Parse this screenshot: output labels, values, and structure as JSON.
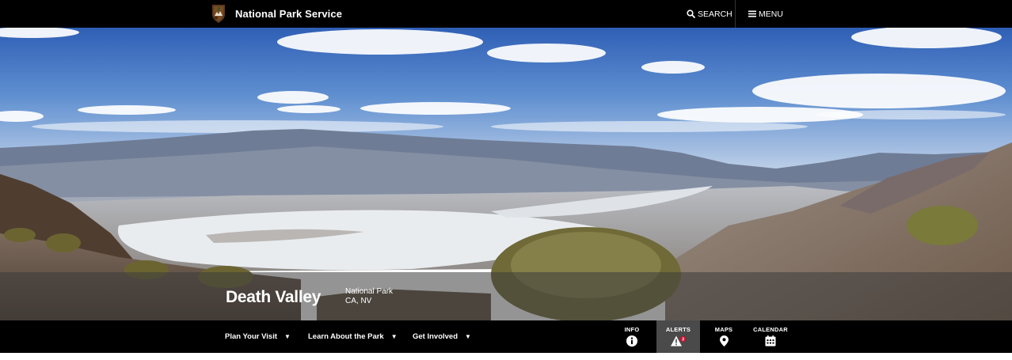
{
  "header": {
    "brand_name": "National Park Service",
    "logo_icon": "nps-arrowhead-icon",
    "search_label": "SEARCH",
    "menu_label": "MENU"
  },
  "hero": {
    "title": "Death Valley",
    "designation": "National Park",
    "location": "CA, NV"
  },
  "nav": {
    "items": [
      {
        "label": "Plan Your Visit",
        "caret": "▼"
      },
      {
        "label": "Learn About the Park",
        "caret": "▼"
      },
      {
        "label": "Get Involved",
        "caret": "▼"
      }
    ]
  },
  "quick_links": {
    "info": {
      "label": "INFO",
      "icon": "info-icon"
    },
    "alerts": {
      "label": "ALERTS",
      "icon": "alert-triangle-icon",
      "count": "3"
    },
    "maps": {
      "label": "MAPS",
      "icon": "map-pin-icon"
    },
    "calendar": {
      "label": "CALENDAR",
      "icon": "calendar-icon"
    }
  },
  "colors": {
    "bar": "#000000",
    "alerts_active_bg": "#4a4a4a",
    "alert_badge": "#c8102e"
  }
}
